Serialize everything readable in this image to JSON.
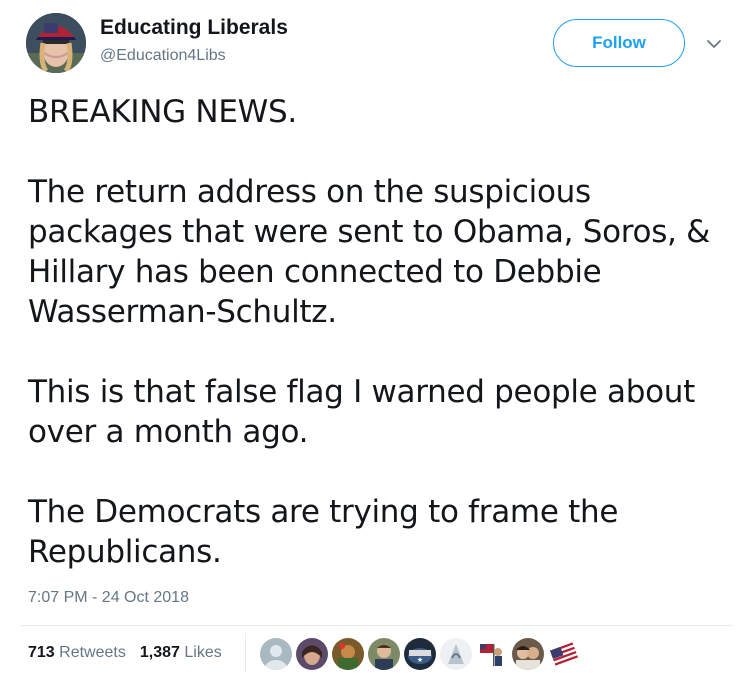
{
  "user": {
    "name": "Educating Liberals",
    "handle": "@Education4Libs",
    "avatar_icon": "profile-avatar"
  },
  "follow_button": {
    "label": "Follow"
  },
  "menu": {
    "icon": "chevron-down-icon"
  },
  "tweet": {
    "paragraphs": [
      "BREAKING NEWS.",
      "The return address on the suspicious packages that were sent to Obama, Soros, & Hillary has been connected to Debbie Wasserman-Schultz.",
      "This is that false flag I warned people about over a month ago.",
      "The Democrats are trying to frame the Republicans."
    ]
  },
  "timestamp": "7:07 PM - 24 Oct 2018",
  "stats": {
    "retweets_count": "713",
    "retweets_label": "Retweets",
    "likes_count": "1,387",
    "likes_label": "Likes"
  },
  "likers": [
    {
      "icon": "default-avatar"
    },
    {
      "icon": "user-avatar"
    },
    {
      "icon": "user-avatar"
    },
    {
      "icon": "user-avatar"
    },
    {
      "icon": "user-avatar"
    },
    {
      "icon": "user-avatar"
    },
    {
      "icon": "user-avatar"
    },
    {
      "icon": "user-avatar"
    },
    {
      "icon": "flag-avatar"
    }
  ],
  "colors": {
    "accent": "#1da1f2",
    "text": "#14171a",
    "secondary": "#657786",
    "border": "#e6ecf0"
  }
}
